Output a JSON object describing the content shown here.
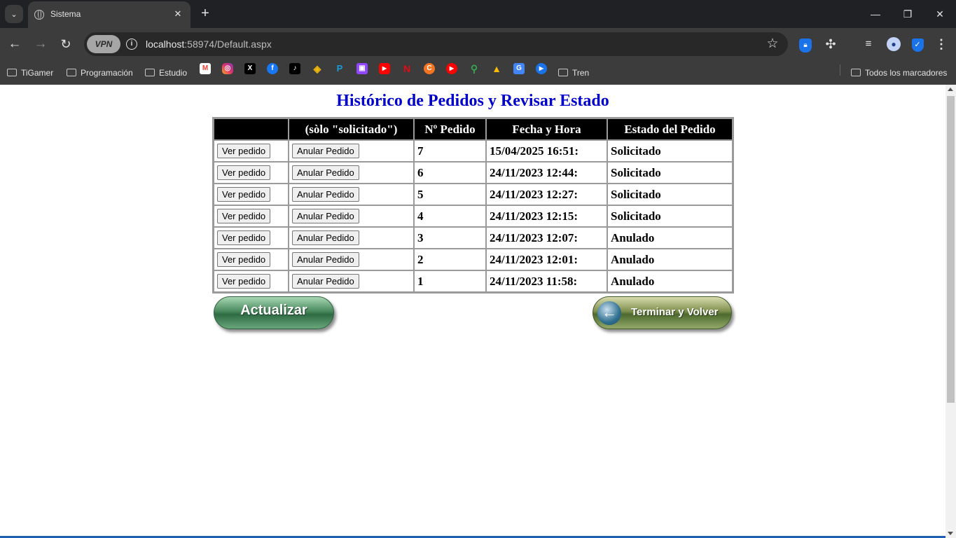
{
  "browser": {
    "tab_title": "Sistema",
    "new_tab": "+",
    "url_host": "localhost",
    "url_rest": ":58974/Default.aspx",
    "vpn_label": "VPN",
    "window_controls": {
      "minimize": "—",
      "maximize": "❐",
      "close": "✕"
    },
    "bookmarks": [
      {
        "label": "TiGamer",
        "type": "folder"
      },
      {
        "label": "Programación",
        "type": "folder"
      },
      {
        "label": "Estudio",
        "type": "folder"
      },
      {
        "label": "Tren",
        "type": "folder"
      }
    ],
    "bookmark_icons": [
      "gmail-icon",
      "instagram-icon",
      "x-icon",
      "facebook-icon",
      "tiktok-icon",
      "binance-icon",
      "paypal-icon",
      "twitch-icon",
      "youtube-icon",
      "netflix-icon",
      "crunchyroll-icon",
      "youtube-music-icon",
      "maps-icon",
      "drive-icon",
      "translate-icon",
      "play-icon"
    ],
    "all_bookmarks": "Todos los marcadores"
  },
  "page": {
    "title": "Histórico de Pedidos y Revisar Estado",
    "table": {
      "headers": [
        "",
        "(sòlo \"solicitado\")",
        "Nº Pedido",
        "Fecha y Hora",
        "Estado del Pedido"
      ],
      "view_button": "Ver pedido",
      "cancel_button": "Anular Pedido",
      "rows": [
        {
          "numero": "7",
          "fecha": "15/04/2025 16:51:",
          "estado": "Solicitado"
        },
        {
          "numero": "6",
          "fecha": "24/11/2023 12:44:",
          "estado": "Solicitado"
        },
        {
          "numero": "5",
          "fecha": "24/11/2023 12:27:",
          "estado": "Solicitado"
        },
        {
          "numero": "4",
          "fecha": "24/11/2023 12:15:",
          "estado": "Solicitado"
        },
        {
          "numero": "3",
          "fecha": "24/11/2023 12:07:",
          "estado": "Anulado"
        },
        {
          "numero": "2",
          "fecha": "24/11/2023 12:01:",
          "estado": "Anulado"
        },
        {
          "numero": "1",
          "fecha": "24/11/2023 11:58:",
          "estado": "Anulado"
        }
      ]
    },
    "refresh_button": "Actualizar",
    "back_button": "Terminar y Volver"
  },
  "colors": {
    "title": "#0000cc",
    "header_bg": "#000000",
    "header_text": "#ffffff",
    "chrome_dark": "#202124",
    "chrome_toolbar": "#3c3c3c"
  }
}
